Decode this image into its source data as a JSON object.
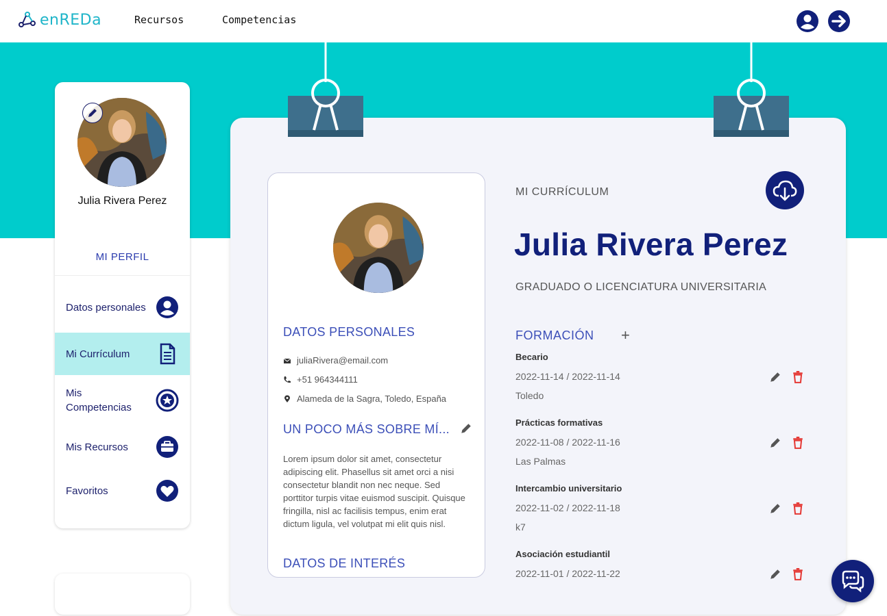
{
  "nav": {
    "logo_text": "enREDa",
    "links": [
      "Recursos",
      "Competencias"
    ],
    "icons": [
      "user-circle-icon",
      "logout-arrow-icon"
    ]
  },
  "sidebar": {
    "user_name": "Julia Rivera Perez",
    "section_title": "MI PERFIL",
    "items": [
      {
        "label": "Datos personales",
        "icon": "user-circle-icon",
        "active": false
      },
      {
        "label": "Mi Currículum",
        "icon": "document-icon",
        "active": true
      },
      {
        "label": "Mis Competencias",
        "icon": "star-badge-icon",
        "active": false
      },
      {
        "label": "Mis Recursos",
        "icon": "briefcase-icon",
        "active": false
      },
      {
        "label": "Favoritos",
        "icon": "heart-icon",
        "active": false
      }
    ]
  },
  "card": {
    "personal_title": "DATOS PERSONALES",
    "email": "juliaRivera@email.com",
    "phone": "+51 964344111",
    "address": "Alameda de la Sagra, Toledo, España",
    "about_title": "UN POCO MÁS SOBRE MÍ...",
    "about_text": "Lorem ipsum dolor sit amet, consectetur adipiscing elit. Phasellus sit amet orci a nisi consectetur blandit non nec neque. Sed porttitor turpis vitae euismod suscipit. Quisque fringilla, nisl ac facilisis tempus, enim erat dictum ligula, vel volutpat mi elit quis nisl.",
    "interest_title": "DATOS DE INTERÉS"
  },
  "cv": {
    "section_label": "MI CURRÍCULUM",
    "name": "Julia Rivera Perez",
    "degree": "GRADUADO O LICENCIATURA UNIVERSITARIA",
    "formacion_title": "FORMACIÓN",
    "formacion_add": "+",
    "entries": [
      {
        "title": "Becario",
        "dates": "2022-11-14 / 2022-11-14",
        "place": "Toledo"
      },
      {
        "title": "Prácticas formativas",
        "dates": "2022-11-08 / 2022-11-16",
        "place": "Las Palmas"
      },
      {
        "title": "Intercambio universitario",
        "dates": "2022-11-02 / 2022-11-18",
        "place": "k7"
      },
      {
        "title": "Asociación estudiantil",
        "dates": "2022-11-01 / 2022-11-22",
        "place": ""
      }
    ]
  },
  "colors": {
    "teal": "#00cccc",
    "navy": "#11207a",
    "accent_blue": "#3c4fb8",
    "active_bg": "#b3eeee",
    "delete_red": "#e53935"
  }
}
